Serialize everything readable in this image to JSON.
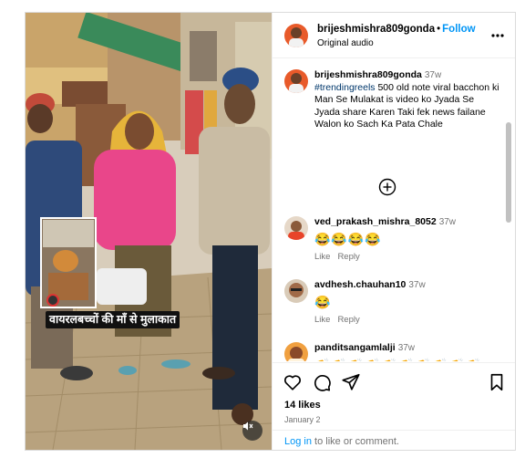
{
  "post": {
    "username": "brijeshmishra809gonda",
    "follow_label": "Follow",
    "subtitle": "Original audio",
    "caption_username": "brijeshmishra809gonda",
    "caption_time": "37w",
    "caption_hashtag": "#trendingreels",
    "caption_text": " 500 old note viral bacchon ki Man Se Mulakat is video ko Jyada Se Jyada share Karen Taki fek news failane Walon ko Sach Ka Pata Chale"
  },
  "video": {
    "overlay_text": "वायरलबच्चों की माँ से मुलाकात",
    "mute_icon": "speaker-muted-icon"
  },
  "comments": [
    {
      "username": "ved_prakash_mishra_8052",
      "time": "37w",
      "text": "😂😂😂😂",
      "like": "Like",
      "reply": "Reply"
    },
    {
      "username": "avdhesh.chauhan10",
      "time": "37w",
      "text": "😂",
      "like": "Like",
      "reply": "Reply"
    },
    {
      "username": "panditsangamlalji",
      "time": "37w",
      "text": "👏👏👏👏👏👏👏👏👏👏"
    }
  ],
  "footer": {
    "likes": "14 likes",
    "date": "January 2",
    "login_link": "Log in",
    "login_rest": " to like or comment."
  },
  "colors": {
    "link_blue": "#0095f6",
    "hashtag": "#00376b",
    "muted_text": "#737373",
    "border": "#dbdbdb"
  }
}
